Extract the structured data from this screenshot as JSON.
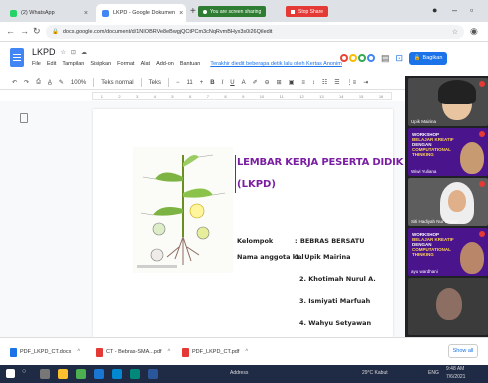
{
  "tabs": [
    {
      "label": "(2) WhatsApp",
      "active": false
    },
    {
      "label": "LKPD - Google Dokumen",
      "active": true
    }
  ],
  "sharing": {
    "label": "You are screen sharing",
    "stop_label": "Stop Share"
  },
  "address": {
    "url": "docs.google.com/document/d/1NIOBRVe8eBwgjQCtPCm3cNqRvmBHyx3s0i26QiIedit"
  },
  "doc": {
    "title": "LKPD",
    "menus": [
      "File",
      "Edit",
      "Tampilan",
      "Sisipkan",
      "Format",
      "Alat",
      "Add-on",
      "Bantuan"
    ],
    "last_edit": "Terakhir diedit beberapa detik lalu oleh Kertas Anonim",
    "share_label": "Bagikan"
  },
  "toolbar": {
    "zoom": "100%",
    "style": "Teks normal",
    "font": "Teks",
    "size": "11"
  },
  "ruler_marks": [
    "1",
    "2",
    "3",
    "4",
    "5",
    "6",
    "7",
    "8",
    "9",
    "10",
    "11",
    "12",
    "13",
    "14",
    "15",
    "16"
  ],
  "page": {
    "title_line1": "LEMBAR KERJA PESERTA DIDIK",
    "title_line2": "(LKPD)",
    "kelompok_label": "Kelompok",
    "kelompok_value": ": BEBRAS BERSATU",
    "anggota_label": "Nama anggota kel",
    "members": [
      "1. Upik Mairina",
      "2. Khotimah Nurul A.",
      "3. Ismiyati Marfuah",
      "4. Wahyu Setyawan"
    ]
  },
  "meet": {
    "workshop_lines": [
      "WORKSHOP",
      "BELAJAR KREATIF",
      "DENGAN",
      "COMPUTATIONAL",
      "THINKING"
    ],
    "participants": [
      "Upik Mairina",
      "Wiwi Yuliana",
      "Siti Hadiyah Nur Ikhsan",
      "ayu wardhani"
    ]
  },
  "downloads": [
    {
      "name": "PDF_LKPD_CT.docx"
    },
    {
      "name": "CT - Bebras-SMA...pdf"
    },
    {
      "name": "PDF_LKPD_CT.pdf"
    }
  ],
  "show_all": "Show all",
  "taskbar": {
    "weather": "29°C Kabut",
    "time": "9:48 AM",
    "date": "7/6/2021",
    "lang": "ENG",
    "mid": "Address"
  }
}
